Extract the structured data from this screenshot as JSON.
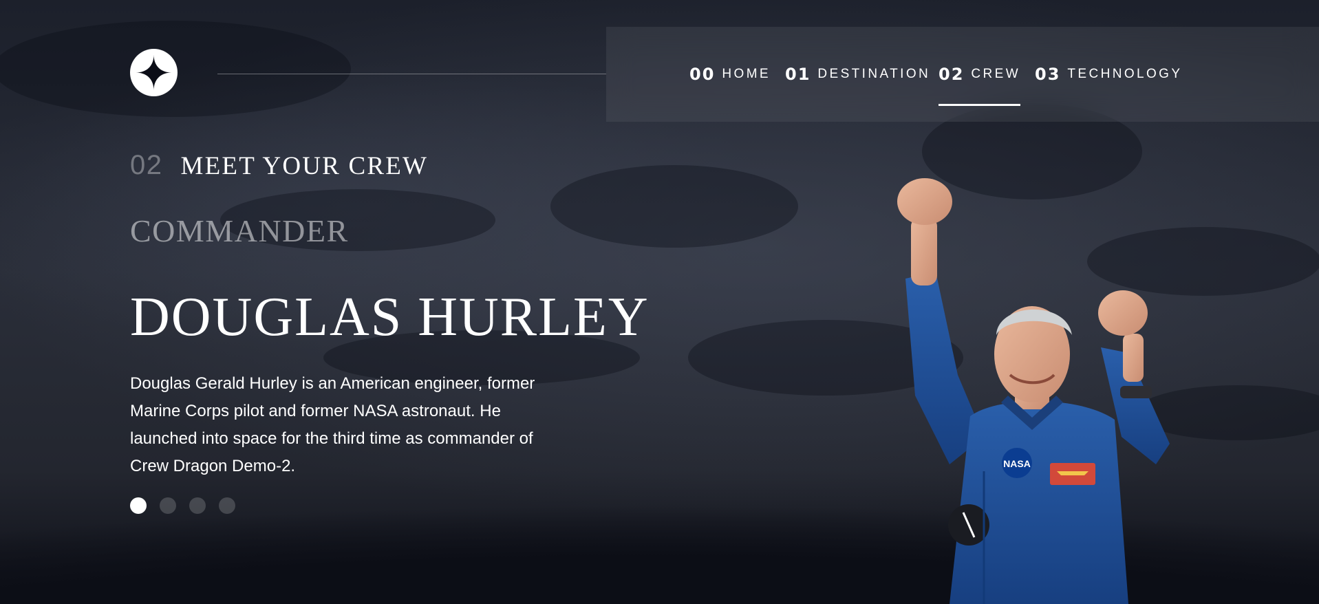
{
  "nav": {
    "items": [
      {
        "number": "00",
        "label": "HOME"
      },
      {
        "number": "01",
        "label": "DESTINATION"
      },
      {
        "number": "02",
        "label": "CREW"
      },
      {
        "number": "03",
        "label": "TECHNOLOGY"
      }
    ],
    "active_index": 2
  },
  "page": {
    "eyebrow_number": "02",
    "eyebrow_text": "MEET YOUR CREW"
  },
  "crew": {
    "role": "COMMANDER",
    "name": "DOUGLAS HURLEY",
    "bio": "Douglas Gerald Hurley is an American engineer, former Marine Corps pilot and former NASA astronaut. He launched into space for the third time as commander of Crew Dragon Demo-2.",
    "slide_count": 4,
    "active_slide": 0,
    "patch_text": "NASA"
  },
  "icons": {
    "logo": "star-logo-icon"
  },
  "colors": {
    "background": "#0b0d17",
    "text": "#ffffff",
    "suit": "#1f4f97"
  }
}
